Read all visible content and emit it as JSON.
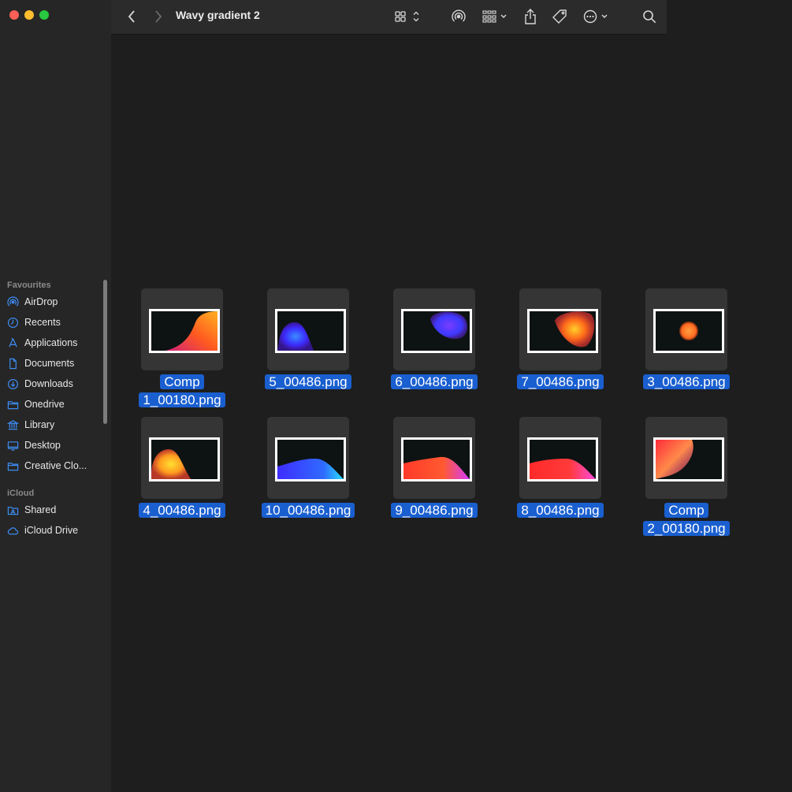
{
  "window": {
    "title": "Wavy gradient 2"
  },
  "toolbar": {
    "back_icon": "chevron-left-icon",
    "forward_icon": "chevron-right-icon",
    "view_icon": "grid-view-icon",
    "airdrop_icon": "airdrop-icon",
    "group_icon": "group-by-icon",
    "share_icon": "share-icon",
    "tag_icon": "tag-icon",
    "more_icon": "ellipsis-circle-icon",
    "search_icon": "search-icon"
  },
  "sidebar": {
    "favourites_header": "Favourites",
    "favourites": [
      {
        "label": "AirDrop",
        "icon": "airdrop-icon"
      },
      {
        "label": "Recents",
        "icon": "clock-icon"
      },
      {
        "label": "Applications",
        "icon": "applications-icon"
      },
      {
        "label": "Documents",
        "icon": "document-icon"
      },
      {
        "label": "Downloads",
        "icon": "download-icon"
      },
      {
        "label": "Onedrive",
        "icon": "folder-icon"
      },
      {
        "label": "Library",
        "icon": "library-icon"
      },
      {
        "label": "Desktop",
        "icon": "desktop-icon"
      },
      {
        "label": "Creative Clo...",
        "icon": "folder-icon"
      }
    ],
    "icloud_header": "iCloud",
    "icloud": [
      {
        "label": "Shared",
        "icon": "shared-folder-icon"
      },
      {
        "label": "iCloud Drive",
        "icon": "cloud-icon"
      }
    ]
  },
  "files": [
    {
      "name_line1": "Comp",
      "name_line2": "1_00180.png",
      "selected": true
    },
    {
      "name_line1": "5_00486.png",
      "name_line2": "",
      "selected": true
    },
    {
      "name_line1": "6_00486.png",
      "name_line2": "",
      "selected": true
    },
    {
      "name_line1": "7_00486.png",
      "name_line2": "",
      "selected": true
    },
    {
      "name_line1": "3_00486.png",
      "name_line2": "",
      "selected": true
    },
    {
      "name_line1": "4_00486.png",
      "name_line2": "",
      "selected": true
    },
    {
      "name_line1": "10_00486.png",
      "name_line2": "",
      "selected": true
    },
    {
      "name_line1": "9_00486.png",
      "name_line2": "",
      "selected": true
    },
    {
      "name_line1": "8_00486.png",
      "name_line2": "",
      "selected": true
    },
    {
      "name_line1": "Comp",
      "name_line2": "2_00180.png",
      "selected": true
    }
  ],
  "colors": {
    "selection": "#1a5fd0",
    "sidebar_icon": "#3d8cf2"
  }
}
